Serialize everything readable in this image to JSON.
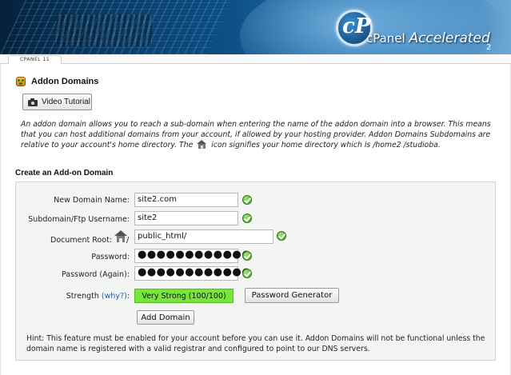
{
  "banner": {
    "logo_cp": "cP",
    "logo_word": "cPanel",
    "logo_accel": "Accelerated",
    "logo_version": "2"
  },
  "tab": {
    "label": "CPANEL 11"
  },
  "page": {
    "title": "Addon Domains",
    "video_button": "Video Tutorial",
    "description_part1": "An addon domain allows you to reach a sub-domain when entering the name of the addon domain into a browser. This means that you can host additional domains from your account, if allowed by your hosting provider. Addon Domains Subdomains are relative to your account's home directory. The",
    "description_part2": "icon signifies your home directory which is /home2 /studioba."
  },
  "form": {
    "section_title": "Create an Add-on Domain",
    "new_domain_label": "New Domain Name:",
    "new_domain_value": "site2.com",
    "subdomain_label": "Subdomain/Ftp Username:",
    "subdomain_value": "site2",
    "docroot_label": "Document Root:",
    "docroot_slash": "/",
    "docroot_value": "public_html/",
    "password_label": "Password:",
    "password_value": "●●●●●●●●●●●●",
    "password_again_label": "Password (Again):",
    "password_again_value": "●●●●●●●●●●●●",
    "strength_label": "Strength",
    "strength_why": "(why?)",
    "strength_colon": ":",
    "strength_value": "Very Strong (100/100)",
    "password_generator_button": "Password Generator",
    "add_domain_button": "Add Domain"
  },
  "hint": {
    "text": "Hint: This feature must be enabled for your account before you can use it. Addon Domains will not be functional unless the domain name is registered with a valid registrar and configured to point to our DNS servers."
  },
  "colors": {
    "strength_bg": "#77e63a",
    "link": "#1a5fb4",
    "check": "#3e9c1f"
  },
  "icons": [
    "addon-domains-icon",
    "camera-icon",
    "home-icon",
    "check-icon"
  ]
}
